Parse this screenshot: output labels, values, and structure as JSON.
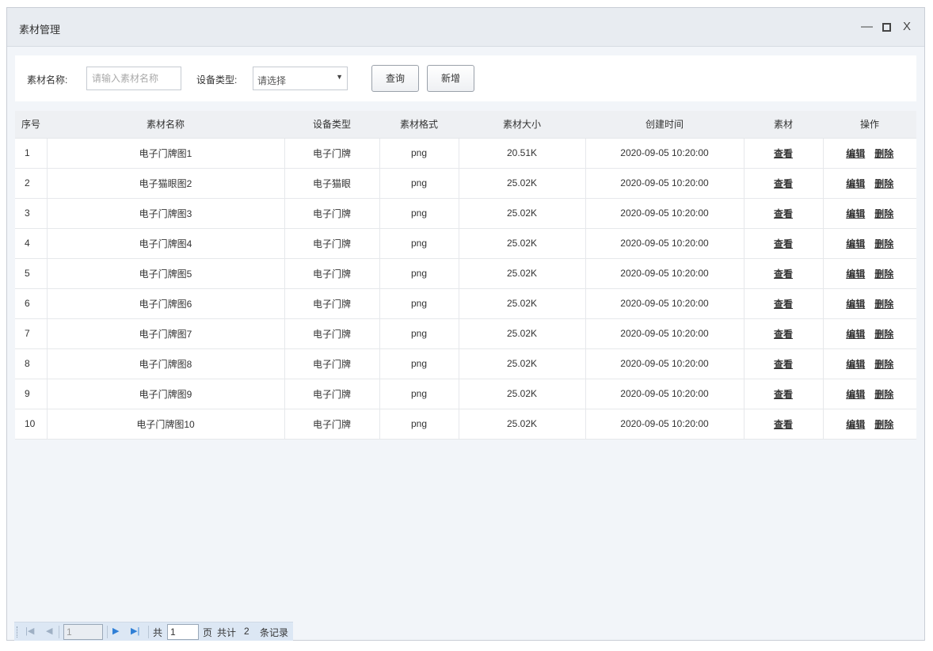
{
  "window": {
    "title": "素材管理",
    "minimize": "—",
    "close": "X"
  },
  "search": {
    "name_label": "素材名称:",
    "name_placeholder": "请输入素材名称",
    "name_value": "",
    "type_label": "设备类型:",
    "type_selected": "请选择",
    "query_button": "查询",
    "add_button": "新增"
  },
  "table": {
    "columns": [
      "序号",
      "素材名称",
      "设备类型",
      "素材格式",
      "素材大小",
      "创建时间",
      "素材",
      "操作"
    ],
    "view_label": "查看",
    "edit_label": "编辑",
    "delete_label": "删除",
    "rows": [
      {
        "no": "1",
        "name": "电子门牌图1",
        "type": "电子门牌",
        "format": "png",
        "size": "20.51K",
        "created": "2020-09-05 10:20:00"
      },
      {
        "no": "2",
        "name": "电子猫眼图2",
        "type": "电子猫眼",
        "format": "png",
        "size": "25.02K",
        "created": "2020-09-05 10:20:00"
      },
      {
        "no": "3",
        "name": "电子门牌图3",
        "type": "电子门牌",
        "format": "png",
        "size": "25.02K",
        "created": "2020-09-05 10:20:00"
      },
      {
        "no": "4",
        "name": "电子门牌图4",
        "type": "电子门牌",
        "format": "png",
        "size": "25.02K",
        "created": "2020-09-05 10:20:00"
      },
      {
        "no": "5",
        "name": "电子门牌图5",
        "type": "电子门牌",
        "format": "png",
        "size": "25.02K",
        "created": "2020-09-05 10:20:00"
      },
      {
        "no": "6",
        "name": "电子门牌图6",
        "type": "电子门牌",
        "format": "png",
        "size": "25.02K",
        "created": "2020-09-05 10:20:00"
      },
      {
        "no": "7",
        "name": "电子门牌图7",
        "type": "电子门牌",
        "format": "png",
        "size": "25.02K",
        "created": "2020-09-05 10:20:00"
      },
      {
        "no": "8",
        "name": "电子门牌图8",
        "type": "电子门牌",
        "format": "png",
        "size": "25.02K",
        "created": "2020-09-05 10:20:00"
      },
      {
        "no": "9",
        "name": "电子门牌图9",
        "type": "电子门牌",
        "format": "png",
        "size": "25.02K",
        "created": "2020-09-05 10:20:00"
      },
      {
        "no": "10",
        "name": "电子门牌图10",
        "type": "电子门牌",
        "format": "png",
        "size": "25.02K",
        "created": "2020-09-05 10:20:00"
      }
    ]
  },
  "pager": {
    "current_page": "1",
    "total_prefix": "共",
    "total_pages": "1",
    "page_suffix": "页",
    "records_prefix": "共计",
    "records_count": "2",
    "records_suffix": "条记录"
  }
}
